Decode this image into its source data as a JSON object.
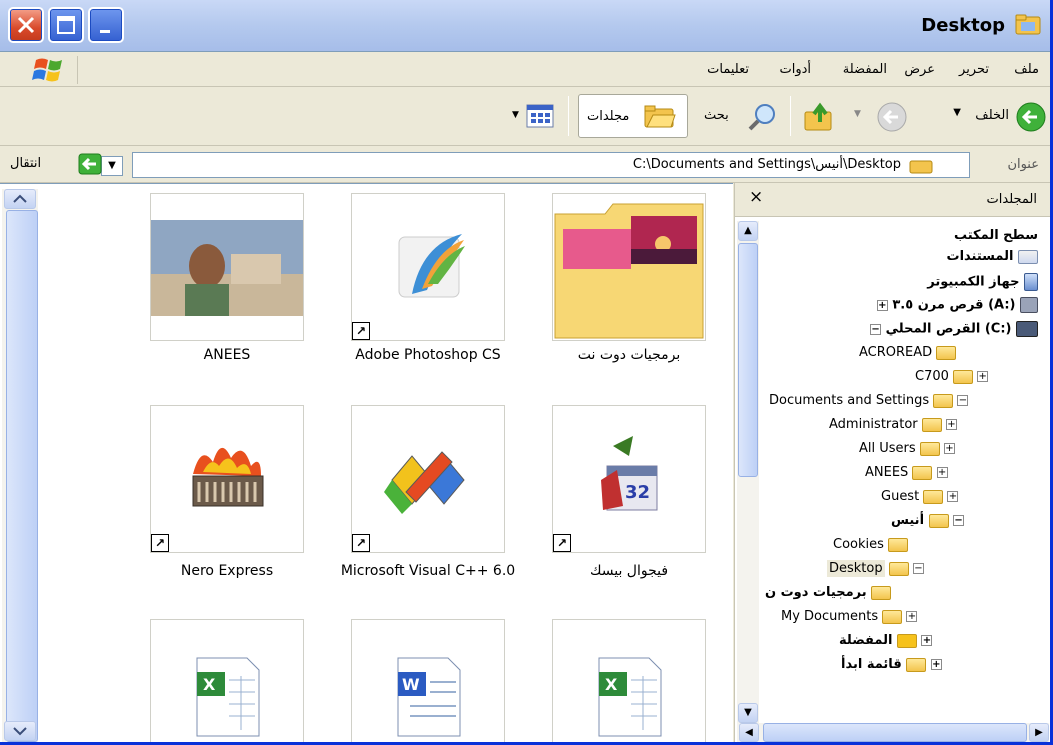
{
  "window": {
    "title": "Desktop"
  },
  "menu": {
    "items": [
      "ملف",
      "تحرير",
      "عرض",
      "المفضلة",
      "أدوات",
      "تعليمات"
    ]
  },
  "toolbar": {
    "back": "الخلف",
    "search": "بحث",
    "folders": "مجلدات"
  },
  "address": {
    "label": "عنوان",
    "path": "C:\\Documents and Settings\\أنيس\\Desktop",
    "go": "انتقال"
  },
  "content": {
    "items": [
      {
        "label": "برمجيات دوت نت",
        "icon": "folder-icon",
        "shortcut": false
      },
      {
        "label": "Adobe Photoshop CS",
        "icon": "photoshop-icon",
        "shortcut": true
      },
      {
        "label": "ANEES",
        "icon": "photo-icon",
        "shortcut": false
      },
      {
        "label": "فيجوال بيسك",
        "icon": "visual-basic-icon",
        "shortcut": true
      },
      {
        "label": "Microsoft Visual C++ 6.0",
        "icon": "visual-cpp-icon",
        "shortcut": true
      },
      {
        "label": "Nero Express",
        "icon": "nero-icon",
        "shortcut": true
      },
      {
        "label": "",
        "icon": "excel-icon"
      },
      {
        "label": "",
        "icon": "word-icon"
      },
      {
        "label": "",
        "icon": "excel-icon"
      }
    ]
  },
  "folders": {
    "title": "المجلدات",
    "close": "×",
    "tree": [
      "سطح المكتب",
      "المستندات",
      "جهاز الكمبيوتر",
      "قرص مرن ٣.٥ (A:)",
      "القرص المحلي (C:)",
      "ACROREAD",
      "C700",
      "Documents and Settings",
      "Administrator",
      "All Users",
      "ANEES",
      "Guest",
      "أنيس",
      "Cookies",
      "Desktop",
      "برمجيات دوت ن",
      "My Documents",
      "المفضلة",
      "قائمة ابدأ"
    ]
  },
  "colors": {
    "accent": "#0831d9",
    "titlebar": "#b4c9ee",
    "chrome": "#ece9d8"
  }
}
